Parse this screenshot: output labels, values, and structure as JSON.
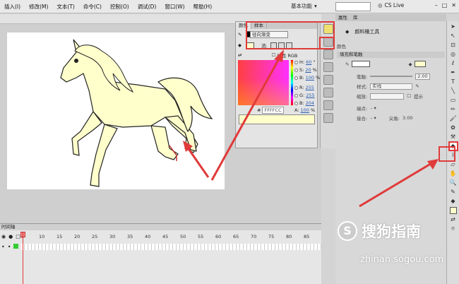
{
  "menubar": {
    "items": [
      "插入(I)",
      "修改(M)",
      "文本(T)",
      "命令(C)",
      "控制(O)",
      "调试(D)",
      "窗口(W)",
      "帮助(H)"
    ],
    "workspace": "基本功能",
    "cs_live": "CS Live"
  },
  "color_panel": {
    "tabs": [
      "颜色",
      "样本"
    ],
    "type_select": "径向渐变",
    "flow_label": "流:",
    "linear_rgb_label": "线性 RGB",
    "hsb": [
      {
        "label": "H:",
        "value": "60",
        "unit": "°"
      },
      {
        "label": "S:",
        "value": "20",
        "unit": "%"
      },
      {
        "label": "B:",
        "value": "100",
        "unit": "%"
      }
    ],
    "rgb": [
      {
        "label": "R:",
        "value": "255"
      },
      {
        "label": "G:",
        "value": "255"
      },
      {
        "label": "B:",
        "value": "204"
      }
    ],
    "alpha": {
      "label": "A:",
      "value": "100",
      "unit": "%"
    },
    "hex": "FFFFCC",
    "stroke_color": "#000000",
    "fill_color": "#ffffcc"
  },
  "properties": {
    "tabs": [
      "属性",
      "库"
    ],
    "tool_name": "颜料桶工具",
    "tool_sub": "颜色",
    "section": "填充和笔触",
    "stroke_label": "笔触:",
    "stroke_value": "2.00",
    "style_label": "样式:",
    "style_value": "实线",
    "scale_label": "缩放:",
    "hint_label": "提示",
    "cap_label": "端点:",
    "join_label": "接合:",
    "miter_label": "尖角:",
    "miter_value": "3.00"
  },
  "timeline": {
    "title": "时间轴",
    "ticks": [
      "5",
      "10",
      "15",
      "20",
      "25",
      "30",
      "35",
      "40",
      "45",
      "50",
      "55",
      "60",
      "65",
      "70",
      "75",
      "80",
      "85",
      "90"
    ]
  },
  "watermark": {
    "logo": "S",
    "title": "搜狗指南",
    "url": "zhinan.sogou.com"
  },
  "colors": {
    "highlight_red": "#e03a3a",
    "horse_fill": "#ffffcc"
  }
}
